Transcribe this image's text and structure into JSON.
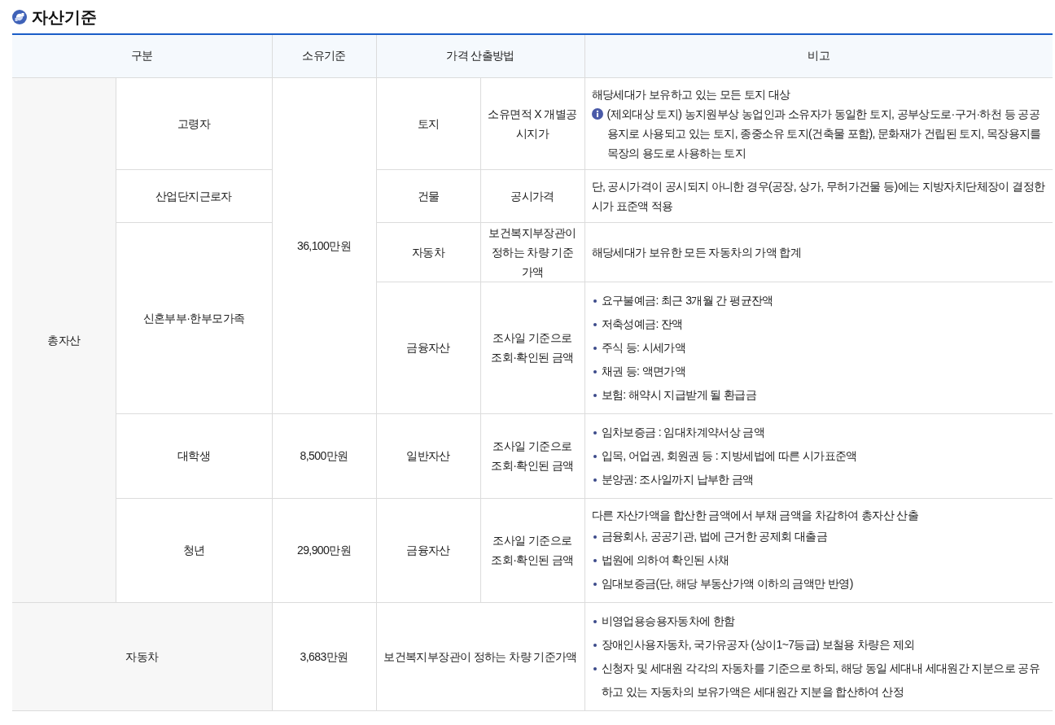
{
  "title": "자산기준",
  "table": {
    "columns": [
      {
        "label": "구분",
        "colspan": 2
      },
      {
        "label": "소유기준"
      },
      {
        "label": "가격 산출방법",
        "colspan": 2
      },
      {
        "label": "비고"
      }
    ],
    "rows": [
      {
        "cells": [
          {
            "text": "총자산",
            "rowspan": 6,
            "shaded": true
          },
          {
            "text": "고령자"
          },
          {
            "text": "36,100만원",
            "rowspan": 4
          },
          {
            "text": "토지"
          },
          {
            "text": "소유면적 X 개별공시지가"
          }
        ],
        "note": {
          "lead": "해당세대가 보유하고 있는 모든 토지 대상",
          "info": "(제외대상 토지) 농지원부상 농업인과 소유자가 동일한 토지, 공부상도로·구거·하천 등 공공용지로 사용되고 있는 토지, 종중소유 토지(건축물 포함), 문화재가 건립된 토지, 목장용지를 목장의 용도로 사용하는 토지"
        }
      },
      {
        "cells": [
          {
            "text": "산업단지근로자"
          },
          {
            "text": "건물"
          },
          {
            "text": "공시가격"
          }
        ],
        "note": {
          "lead": "단, 공시가격이 공시되지 아니한 경우(공장, 상가, 무허가건물 등)에는 지방자치단체장이 결정한 시가 표준액 적용"
        }
      },
      {
        "cells": [
          {
            "text": "신혼부부·한부모가족",
            "rowspan": 2
          },
          {
            "text": "자동차"
          },
          {
            "text": "보건복지부장관이 정하는 차량 기준가액"
          }
        ],
        "note": {
          "lead": "해당세대가 보유한 모든 자동차의 가액 합계"
        }
      },
      {
        "cells": [
          {
            "text": "금융자산"
          },
          {
            "text": "조사일 기준으로 조회·확인된 금액"
          }
        ],
        "note": {
          "bullets": [
            "요구불예금: 최근 3개월 간 평균잔액",
            "저축성예금: 잔액",
            "주식 등: 시세가액",
            "채권 등: 액면가액",
            "보험: 해약시 지급받게 될 환급금"
          ]
        }
      },
      {
        "cells": [
          {
            "text": "대학생"
          },
          {
            "text": "8,500만원"
          },
          {
            "text": "일반자산"
          },
          {
            "text": "조사일 기준으로 조회·확인된 금액"
          }
        ],
        "note": {
          "bullets": [
            "임차보증금 : 임대차계약서상 금액",
            "입목, 어업권, 회원권 등 : 지방세법에 따른 시가표준액",
            "분양권: 조사일까지 납부한 금액"
          ]
        }
      },
      {
        "cells": [
          {
            "text": "청년"
          },
          {
            "text": "29,900만원"
          },
          {
            "text": "금융자산"
          },
          {
            "text": "조사일 기준으로 조회·확인된 금액"
          }
        ],
        "note": {
          "lead": "다른 자산가액을 합산한 금액에서 부채 금액을 차감하여 총자산 산출",
          "bullets": [
            "금융회사, 공공기관, 법에 근거한 공제회 대출금",
            "법원에 의하여 확인된 사채",
            "임대보증금(단, 해당 부동산가액 이하의 금액만 반영)"
          ]
        }
      },
      {
        "cells": [
          {
            "text": "자동차",
            "colspan": 2,
            "shaded": true
          },
          {
            "text": "3,683만원"
          },
          {
            "text": "보건복지부장관이 정하는 차량 기준가액",
            "colspan": 2
          }
        ],
        "note": {
          "bullets": [
            "비영업용승용자동차에 한함",
            "장애인사용자동차, 국가유공자 (상이1~7등급) 보철용 차량은 제외",
            "신청자 및 세대원 각각의 자동차를 기준으로 하되, 해당 동일 세대내 세대원간 지분으로 공유하고 있는 자동차의 보유가액은 세대원간 지분을 합산하여 산정"
          ]
        }
      }
    ]
  }
}
